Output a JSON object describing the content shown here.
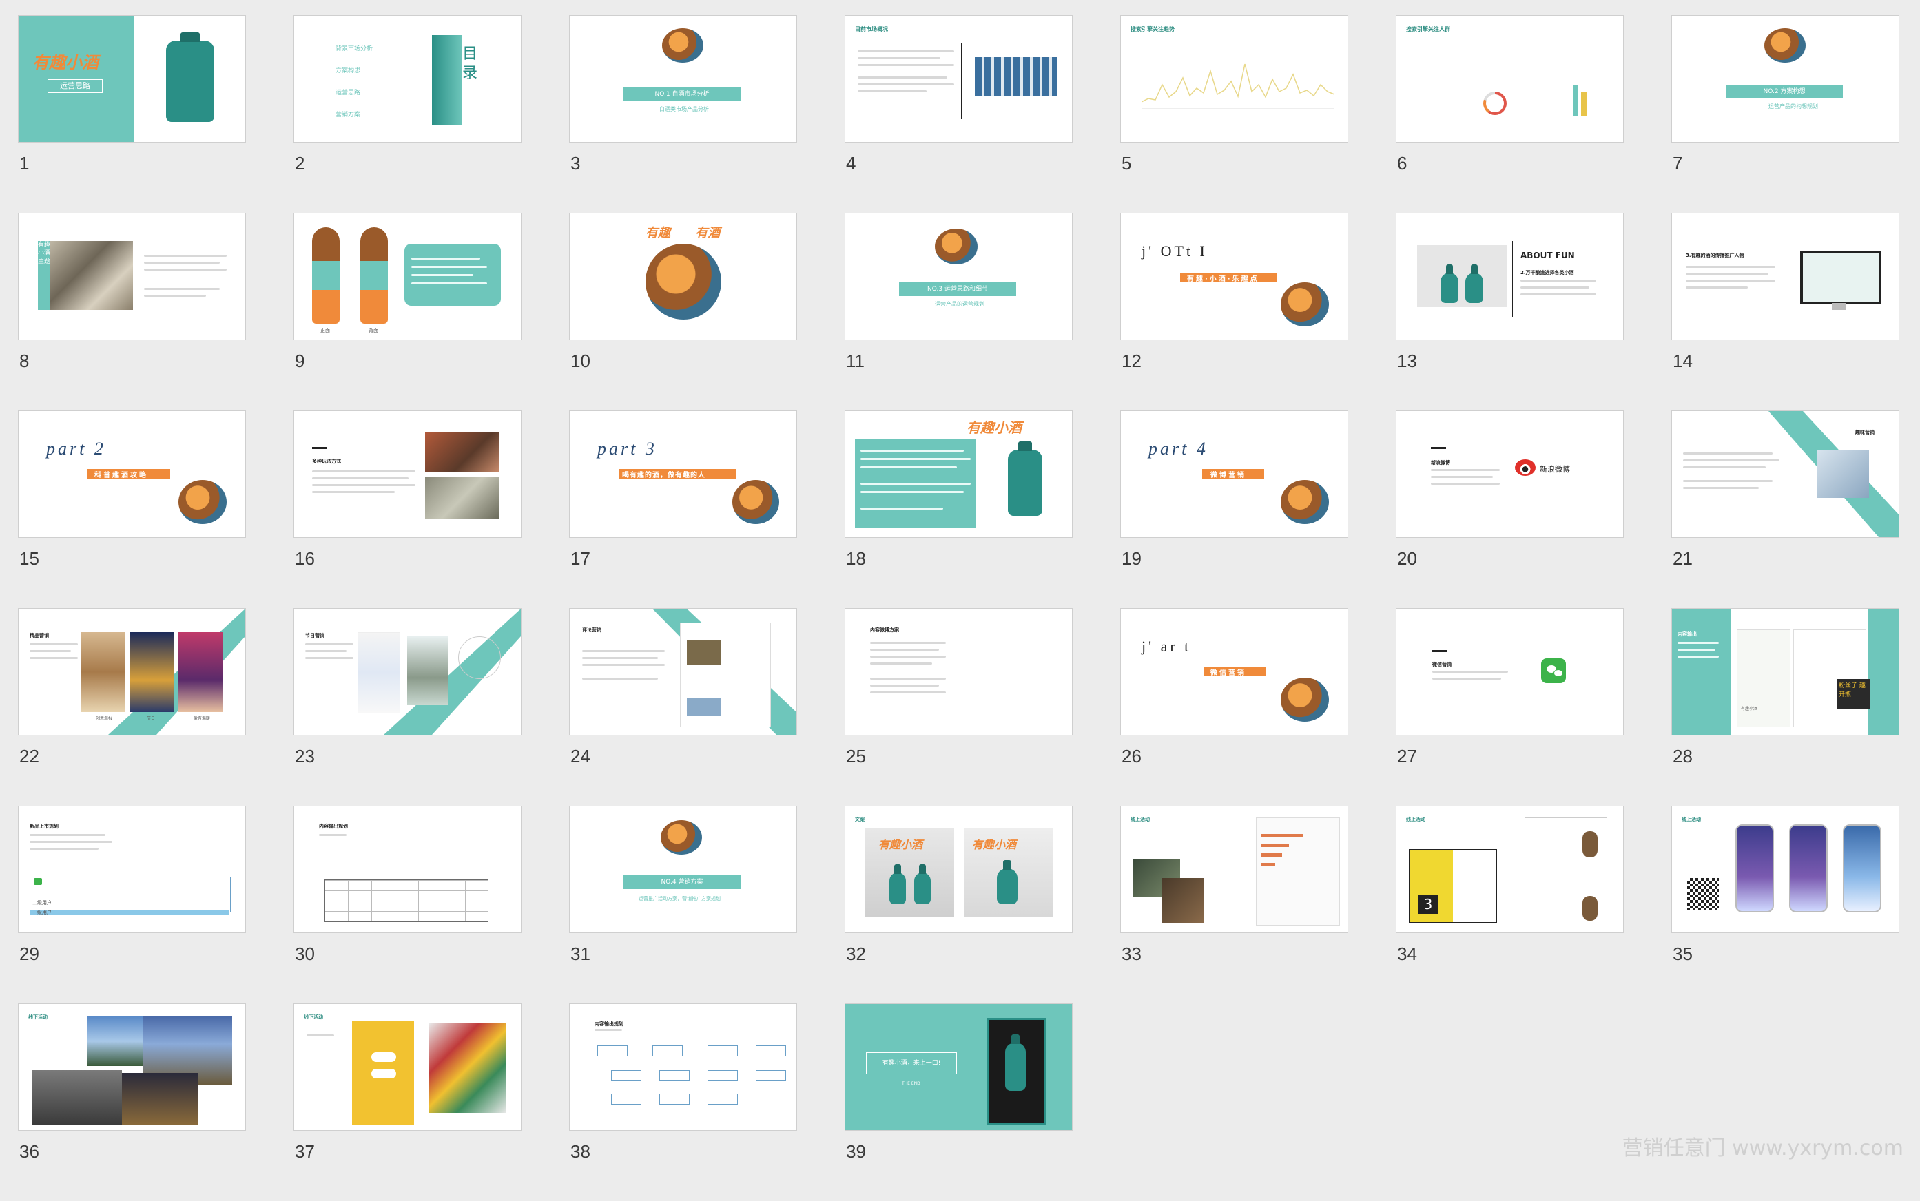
{
  "window": {
    "watermark": "营销任意门 www.yxrym.com"
  },
  "colors": {
    "accent": "#6ec6bb",
    "orange": "#f08a3a",
    "background": "#ececec"
  },
  "slides": [
    {
      "num": "1",
      "title": "有趣小酒",
      "subtitle": "运营思路"
    },
    {
      "num": "2",
      "items": [
        "背景市场分析",
        "方案构思",
        "运营思路",
        "营销方案"
      ],
      "side": "目录"
    },
    {
      "num": "3",
      "banner": "NO.1 自酒市场分析",
      "caption": "白酒类市场产品分析"
    },
    {
      "num": "4",
      "heading": "目前市场概况"
    },
    {
      "num": "5",
      "heading": "搜索引擎关注趋势"
    },
    {
      "num": "6",
      "heading": "搜索引擎关注人群"
    },
    {
      "num": "7",
      "banner": "NO.2 方案构想",
      "caption": "运营产品的构想规划"
    },
    {
      "num": "8",
      "side": "有趣小酒主题"
    },
    {
      "num": "9",
      "labels": [
        "正面",
        "背面"
      ]
    },
    {
      "num": "10",
      "title": "有趣 有酒"
    },
    {
      "num": "11",
      "banner": "NO.3 运营思路和细节",
      "caption": "运营产品的运营规划"
    },
    {
      "num": "12",
      "big": "j' OTt I",
      "bar": "有趣·小酒·乐趣点"
    },
    {
      "num": "13",
      "heading": "ABOUT FUN",
      "subheading": "2.万千酿造选择各类小酒"
    },
    {
      "num": "14",
      "heading": "3.有趣的酒的传播推广人物"
    },
    {
      "num": "15",
      "big": "part 2",
      "bar": "科普趣酒攻略"
    },
    {
      "num": "16",
      "heading": "多种玩法方式"
    },
    {
      "num": "17",
      "big": "part 3",
      "bar": "喝有趣的酒，做有趣的人"
    },
    {
      "num": "18",
      "title": "有趣小酒"
    },
    {
      "num": "19",
      "big": "part 4",
      "bar": "微博营销"
    },
    {
      "num": "20",
      "heading": "新浪微博",
      "logo": "新浪微博"
    },
    {
      "num": "21",
      "heading": "趣味营销"
    },
    {
      "num": "22",
      "heading": "精品营销",
      "labels": [
        "创意海报",
        "节日",
        "爱有温暖"
      ]
    },
    {
      "num": "23",
      "heading": "节日营销"
    },
    {
      "num": "24",
      "heading": "评论营销"
    },
    {
      "num": "25",
      "heading": "内容微博方案"
    },
    {
      "num": "26",
      "big": "j' ar t",
      "bar": "微信营销"
    },
    {
      "num": "27",
      "heading": "微信营销"
    },
    {
      "num": "28",
      "heading": "内容输出",
      "labels": [
        "有趣小酒",
        "粉丝子 趣开瓶"
      ]
    },
    {
      "num": "29",
      "heading": "新品上市规划",
      "rows": [
        "二级用户",
        "一级用户"
      ]
    },
    {
      "num": "30",
      "heading": "内容输出规划"
    },
    {
      "num": "31",
      "banner": "NO.4 营销方案",
      "caption": "运营推广活动方案，营销推广方案规划"
    },
    {
      "num": "32",
      "heading": "文案",
      "title": "有趣小酒"
    },
    {
      "num": "33",
      "heading": "线上活动"
    },
    {
      "num": "34",
      "heading": "线上活动"
    },
    {
      "num": "35",
      "heading": "线上活动"
    },
    {
      "num": "36",
      "heading": "线下活动"
    },
    {
      "num": "37",
      "heading": "线下活动"
    },
    {
      "num": "38",
      "heading": "内容输出规划"
    },
    {
      "num": "39",
      "slogan": "有趣小酒，来上一口!",
      "caption": "THE END"
    }
  ]
}
